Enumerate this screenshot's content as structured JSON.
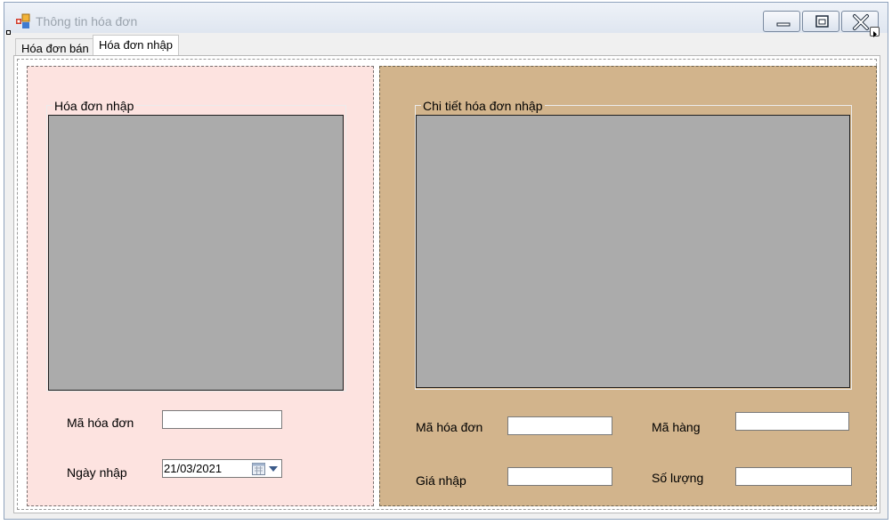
{
  "window": {
    "title": "Thông tin hóa đơn",
    "controls": {
      "minimize": "minimize-icon",
      "maximize": "maximize-icon",
      "close": "close-icon"
    }
  },
  "tabs": [
    {
      "label": "Hóa đơn bán",
      "selected": false
    },
    {
      "label": "Hóa đơn nhập",
      "selected": true
    }
  ],
  "left_panel": {
    "group_title": "Hóa đơn nhập",
    "fields": {
      "ma_hoa_don": {
        "label": "Mã hóa đơn",
        "value": ""
      },
      "ngay_nhap": {
        "label": "Ngày nhập",
        "value": "21/03/2021"
      }
    }
  },
  "right_panel": {
    "group_title": "Chi tiết hóa đơn nhập",
    "fields": {
      "ma_hoa_don": {
        "label": "Mã hóa đơn",
        "value": ""
      },
      "ma_hang": {
        "label": "Mã hàng",
        "value": ""
      },
      "gia_nhap": {
        "label": "Giá nhập",
        "value": ""
      },
      "so_luong": {
        "label": "Số lượng",
        "value": ""
      }
    }
  },
  "colors": {
    "left_panel_bg": "#fde3e0",
    "right_panel_bg": "#d2b48c",
    "grid_bg": "#ababab"
  }
}
